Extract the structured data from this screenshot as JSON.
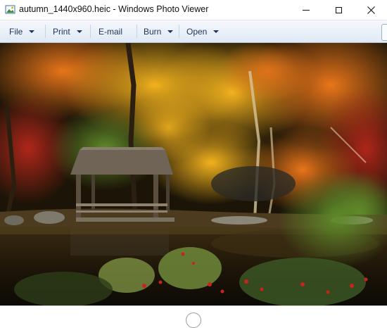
{
  "window": {
    "title": "autumn_1440x960.heic - Windows Photo Viewer",
    "app_icon": "photo-viewer-icon",
    "controls": [
      "minimize-icon",
      "maximize-icon",
      "close-icon"
    ]
  },
  "menu": {
    "items": [
      {
        "label": "File",
        "has_dropdown": true
      },
      {
        "label": "Print",
        "has_dropdown": true
      },
      {
        "label": "E-mail",
        "has_dropdown": false
      },
      {
        "label": "Burn",
        "has_dropdown": true
      },
      {
        "label": "Open",
        "has_dropdown": true
      }
    ]
  },
  "photo": {
    "subject": "autumn-foliage-gazebo-pond"
  },
  "bottom": {
    "control_icon": "play-slideshow-icon"
  },
  "colors": {
    "menubar_top": "#f5f8fc",
    "menubar_bottom": "#dfe9f5",
    "menu_text": "#1e3556"
  }
}
